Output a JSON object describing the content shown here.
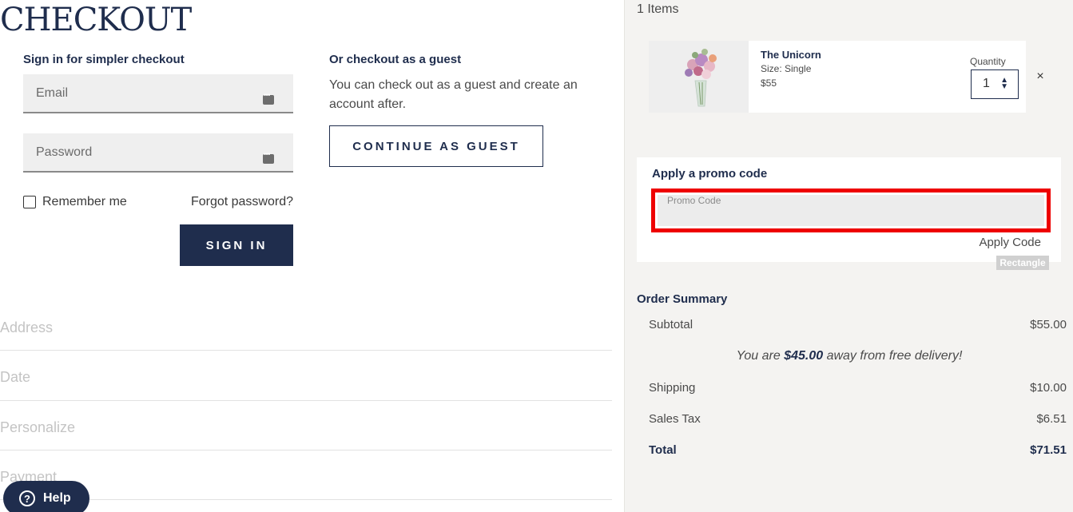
{
  "checkout": {
    "title": "CHECKOUT",
    "signin": {
      "heading": "Sign in for simpler checkout",
      "email_placeholder": "Email",
      "password_placeholder": "Password",
      "remember_label": "Remember me",
      "forgot_label": "Forgot password?",
      "signin_button": "SIGN IN"
    },
    "guest": {
      "heading": "Or checkout as a guest",
      "text": "You can check out as a guest and create an account after.",
      "button": "CONTINUE AS GUEST"
    },
    "steps": [
      "Address",
      "Date",
      "Personalize",
      "Payment"
    ],
    "help_label": "Help"
  },
  "cart": {
    "items_count": "1 Items",
    "item": {
      "name": "The Unicorn",
      "size": "Size: Single",
      "price": "$55",
      "quantity_label": "Quantity",
      "quantity": "1",
      "remove_symbol": "×"
    }
  },
  "promo": {
    "heading": "Apply a promo code",
    "placeholder": "Promo Code",
    "apply_label": "Apply Code",
    "overlay_badge": "Rectangle"
  },
  "summary": {
    "heading": "Order Summary",
    "subtotal_label": "Subtotal",
    "subtotal_value": "$55.00",
    "free_delivery_prefix": "You are ",
    "free_delivery_amount": "$45.00",
    "free_delivery_suffix": " away from free delivery!",
    "shipping_label": "Shipping",
    "shipping_value": "$10.00",
    "tax_label": "Sales Tax",
    "tax_value": "$6.51",
    "total_label": "Total",
    "total_value": "$71.51"
  }
}
